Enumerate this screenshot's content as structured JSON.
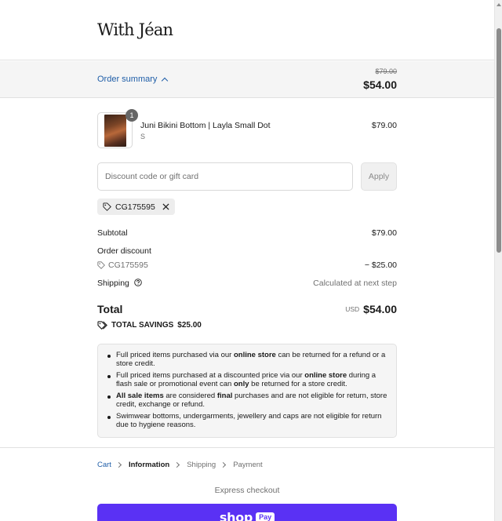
{
  "brand": {
    "logo_text": "With Jéan"
  },
  "summary_toggle": {
    "label": "Order summary",
    "original_total": "$79.00",
    "total": "$54.00"
  },
  "cart_items": [
    {
      "name": "Juni Bikini Bottom | Layla Small Dot",
      "variant": "S",
      "quantity": "1",
      "price": "$79.00"
    }
  ],
  "discount": {
    "placeholder": "Discount code or gift card",
    "value": "",
    "apply_label": "Apply",
    "applied_code": "CG175595"
  },
  "totals": {
    "subtotal_label": "Subtotal",
    "subtotal_value": "$79.00",
    "order_discount_label": "Order discount",
    "discount_code": "CG175595",
    "discount_value": "− $25.00",
    "shipping_label": "Shipping",
    "shipping_value": "Calculated at next step",
    "total_label": "Total",
    "currency": "USD",
    "total_value": "$54.00",
    "savings_label": "TOTAL SAVINGS",
    "savings_value": "$25.00"
  },
  "policy": {
    "items": [
      {
        "parts": [
          {
            "t": "Full priced items purchased via our ",
            "b": false
          },
          {
            "t": "online store",
            "b": true
          },
          {
            "t": " can be returned for a refund or a store credit.",
            "b": false
          }
        ]
      },
      {
        "parts": [
          {
            "t": "Full priced items purchased at a discounted price via our ",
            "b": false
          },
          {
            "t": "online store",
            "b": true
          },
          {
            "t": " during a flash sale or promotional event can ",
            "b": false
          },
          {
            "t": "only",
            "b": true
          },
          {
            "t": " be returned for a store credit.",
            "b": false
          }
        ]
      },
      {
        "parts": [
          {
            "t": "All sale items",
            "b": true
          },
          {
            "t": " are considered ",
            "b": false
          },
          {
            "t": "final",
            "b": true
          },
          {
            "t": " purchases and are not eligible for return, store credit, exchange or refund.",
            "b": false
          }
        ]
      },
      {
        "parts": [
          {
            "t": "Swimwear bottoms, undergarments, jewellery and caps are not eligible for return due to hygiene reasons.",
            "b": false
          }
        ]
      }
    ]
  },
  "breadcrumb": {
    "cart": "Cart",
    "information": "Information",
    "shipping": "Shipping",
    "payment": "Payment"
  },
  "express_checkout": {
    "label": "Express checkout",
    "shop_pay_text": "shop",
    "shop_pay_badge": "Pay"
  },
  "colors": {
    "link": "#1f5ea8",
    "shop_pay": "#5a31f4",
    "summary_bg": "#f5f5f5"
  }
}
